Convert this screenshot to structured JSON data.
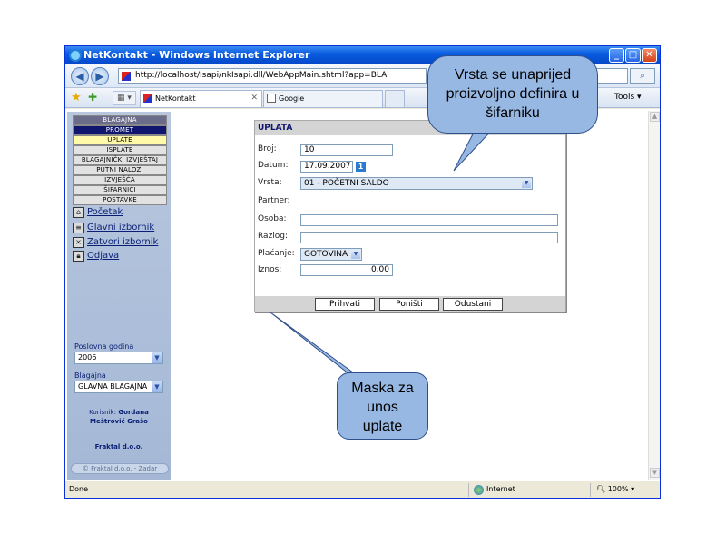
{
  "browser": {
    "title": "NetKontakt - Windows Internet Explorer",
    "url": "http://localhost/Isapi/nkIsapi.dll/WebAppMain.shtml?app=BLA",
    "tabs": [
      {
        "label": "NetKontakt",
        "close": "✕"
      },
      {
        "label": "Google"
      }
    ],
    "tools_label": "Tools",
    "nav_back": "◀",
    "nav_forward": "▶",
    "search_icon": "search-icon",
    "status": {
      "left": "Done",
      "zone": "Internet",
      "zoom": "100%"
    }
  },
  "sidebar": {
    "menu": [
      {
        "label": "BLAGAJNA",
        "style": "header"
      },
      {
        "label": "PROMET",
        "style": "promet"
      },
      {
        "label": "UPLATE",
        "style": "uplate"
      },
      {
        "label": "ISPLATE",
        "style": "normal"
      },
      {
        "label": "BLAGAJNIČKI IZVJEŠTAJ",
        "style": "normal"
      },
      {
        "label": "PUTNI NALOZI",
        "style": "normal"
      },
      {
        "label": "IZVJEŠĆA",
        "style": "normal"
      },
      {
        "label": "ŠIFARNICI",
        "style": "normal"
      },
      {
        "label": "POSTAVKE",
        "style": "normal"
      }
    ],
    "links": [
      {
        "label": "Početak",
        "icon": "home-icon"
      },
      {
        "label": "Glavni izbornik",
        "icon": "menu-icon"
      },
      {
        "label": "Zatvori izbornik",
        "icon": "close-menu-icon"
      },
      {
        "label": "Odjava",
        "icon": "lock-icon"
      }
    ],
    "year_label": "Poslovna godina",
    "year_value": "2006",
    "cashbox_label": "Blagajna",
    "cashbox_value": "GLAVNA BLAGAJNA",
    "user_prefix": "Korisnik:",
    "user_first": "Gordana",
    "user_last": "Meštrović Grašo",
    "company": "Fraktal d.o.o.",
    "copyright": "© Fraktal d.o.o. - Zadar"
  },
  "form": {
    "title": "UPLATA",
    "broj_label": "Broj:",
    "broj_value": "10",
    "datum_label": "Datum:",
    "datum_value": "17.09.2007",
    "calendar_glyph": "1",
    "vrsta_label": "Vrsta:",
    "vrsta_value": "01 - POČETNI SALDO",
    "partner_label": "Partner:",
    "osoba_label": "Osoba:",
    "osoba_value": "",
    "razlog_label": "Razlog:",
    "razlog_value": "",
    "placanje_label": "Plaćanje:",
    "placanje_value": "GOTOVINA",
    "iznos_label": "Iznos:",
    "iznos_value": "0,00",
    "buttons": {
      "accept": "Prihvati",
      "reset": "Poništi",
      "cancel": "Odustani"
    }
  },
  "callouts": {
    "top_line1": "Vrsta se unaprijed",
    "top_line2": "proizvoljno definira u",
    "top_line3": "šifarniku",
    "bottom_line1": "Maska za",
    "bottom_line2": "unos",
    "bottom_line3": "uplate"
  },
  "colors": {
    "titlebar": "#0a5ce0",
    "sidebar": "#a4b8d6",
    "menu_active": "#10166e",
    "menu_selected": "#fff9a8",
    "callout": "#97b8e3"
  }
}
